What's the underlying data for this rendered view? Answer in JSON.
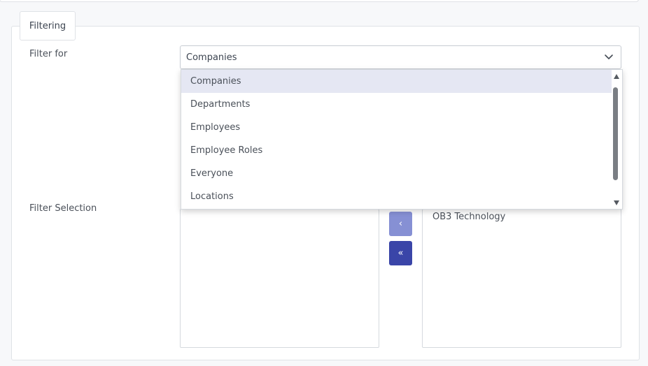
{
  "panel": {
    "legend": "Filtering"
  },
  "filter_for": {
    "label": "Filter for",
    "selected": "Companies",
    "options": [
      "Companies",
      "Departments",
      "Employees",
      "Employee Roles",
      "Everyone",
      "Locations"
    ],
    "highlighted_index": 0
  },
  "filter_selection": {
    "label": "Filter Selection",
    "available": [],
    "selected": [
      "OB3 Technology"
    ],
    "move_left_button": "‹",
    "move_all_left_button": "«"
  },
  "icons": {
    "select_toggle": "chevron-down-icon",
    "move_left": "chevron-left-icon",
    "move_all_left": "double-chevron-left-icon"
  },
  "colors": {
    "primary": "#3a45a8",
    "primary_light": "#8690d4",
    "option_highlight": "#e5e7f3"
  }
}
